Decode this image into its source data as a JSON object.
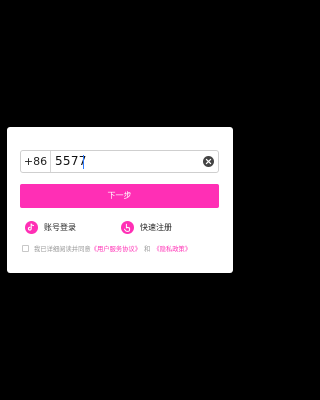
{
  "login": {
    "country_code": "+86",
    "phone_value": "5577",
    "next_label": "下一步"
  },
  "options": {
    "account_login": "账号登录",
    "quick_register": "快速注册"
  },
  "agreement": {
    "prefix": "我已详细阅读并同意",
    "user_agreement": "《用户服务协议》",
    "and": "和",
    "privacy_policy": "《隐私政策》",
    "checked": false
  },
  "icons": {
    "clear": "clear-icon",
    "account_login": "tiktok-note-icon",
    "quick_register": "hand-finger-icon"
  },
  "colors": {
    "background": "#000000",
    "card": "#ffffff",
    "accent": "#ff2fb5",
    "caret": "#2f7bff",
    "muted_text": "#999999"
  }
}
